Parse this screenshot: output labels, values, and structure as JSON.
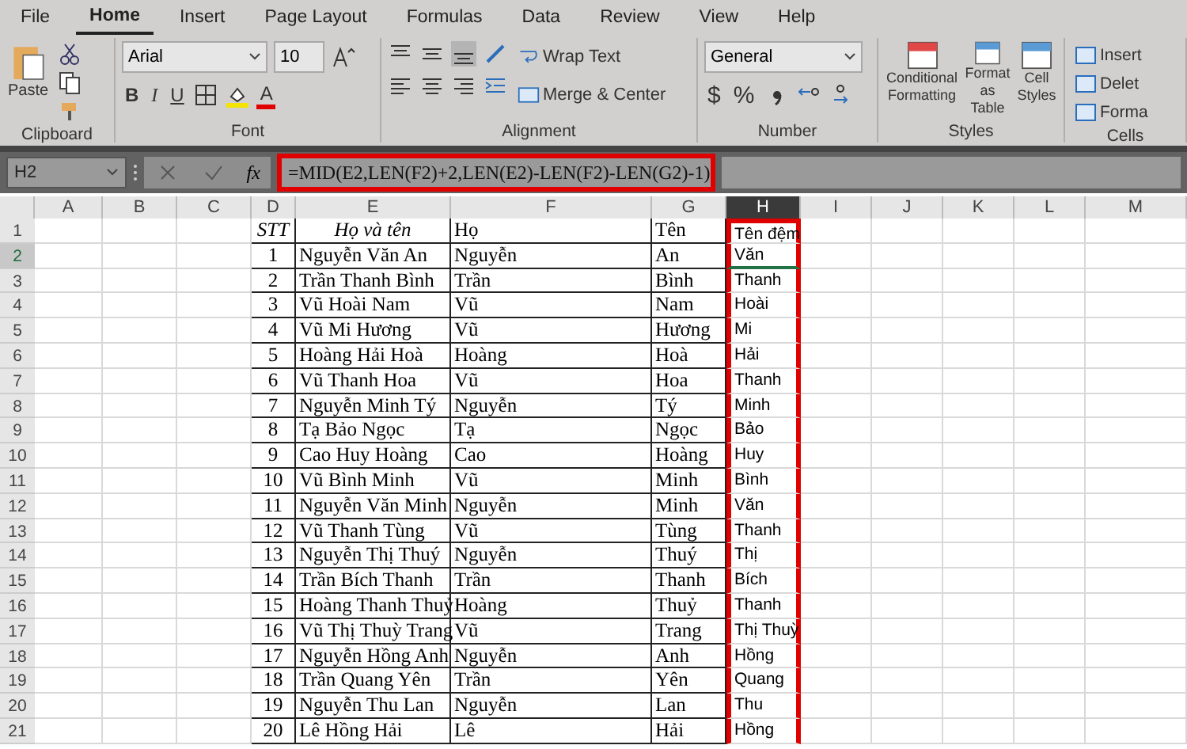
{
  "menu_tabs": [
    {
      "label": "File",
      "selected": false
    },
    {
      "label": "Home",
      "selected": true
    },
    {
      "label": "Insert",
      "selected": false
    },
    {
      "label": "Page Layout",
      "selected": false
    },
    {
      "label": "Formulas",
      "selected": false
    },
    {
      "label": "Data",
      "selected": false
    },
    {
      "label": "Review",
      "selected": false
    },
    {
      "label": "View",
      "selected": false
    },
    {
      "label": "Help",
      "selected": false
    }
  ],
  "ribbon": {
    "clipboard": {
      "label": "Clipboard",
      "paste": "Paste"
    },
    "font": {
      "label": "Font",
      "font_name": "Arial",
      "font_size": "10",
      "bold": "B",
      "italic": "I",
      "underline": "U",
      "font_color": "A"
    },
    "alignment": {
      "label": "Alignment",
      "wrap_text": "Wrap Text",
      "merge": "Merge & Center"
    },
    "number": {
      "label": "Number",
      "format": "General",
      "currency": "$",
      "percent": "%"
    },
    "styles": {
      "label": "Styles",
      "buttons": [
        "Conditional Formatting",
        "Format as Table",
        "Cell Styles"
      ]
    },
    "cells": {
      "label": "Cells",
      "buttons": [
        "Insert",
        "Delet",
        "Forma"
      ]
    }
  },
  "formula_bar": {
    "name_box": "H2",
    "fx": "fx",
    "formula": "=MID(E2,LEN(F2)+2,LEN(E2)-LEN(F2)-LEN(G2)-1)",
    "highlighted": true
  },
  "columns": [
    {
      "label": "A",
      "selected": false,
      "highlighted": false
    },
    {
      "label": "B",
      "selected": false,
      "highlighted": false
    },
    {
      "label": "C",
      "selected": false,
      "highlighted": false
    },
    {
      "label": "D",
      "selected": false,
      "highlighted": false
    },
    {
      "label": "E",
      "selected": false,
      "highlighted": false
    },
    {
      "label": "F",
      "selected": false,
      "highlighted": false
    },
    {
      "label": "G",
      "selected": false,
      "highlighted": false
    },
    {
      "label": "H",
      "selected": true,
      "highlighted": true
    },
    {
      "label": "I",
      "selected": false,
      "highlighted": false
    },
    {
      "label": "J",
      "selected": false,
      "highlighted": false
    },
    {
      "label": "K",
      "selected": false,
      "highlighted": false
    },
    {
      "label": "L",
      "selected": false,
      "highlighted": false
    },
    {
      "label": "M",
      "selected": false,
      "highlighted": false
    }
  ],
  "rows": [
    {
      "number": "1",
      "kind": "header",
      "selected": false,
      "stt": "STT",
      "full_name": "Họ và tên",
      "ho": "Họ",
      "ten": "Tên",
      "ten_dem": "Tên đệm"
    },
    {
      "number": "2",
      "kind": "data",
      "selected": true,
      "stt": "1",
      "full_name": "Nguyễn Văn An",
      "ho": "Nguyễn",
      "ten": "An",
      "ten_dem": "Văn"
    },
    {
      "number": "3",
      "kind": "data",
      "selected": false,
      "stt": "2",
      "full_name": "Trần Thanh Bình",
      "ho": "Trần",
      "ten": "Bình",
      "ten_dem": "Thanh"
    },
    {
      "number": "4",
      "kind": "data",
      "selected": false,
      "stt": "3",
      "full_name": "Vũ Hoài Nam",
      "ho": "Vũ",
      "ten": "Nam",
      "ten_dem": "Hoài"
    },
    {
      "number": "5",
      "kind": "data",
      "selected": false,
      "stt": "4",
      "full_name": "Vũ Mi Hương",
      "ho": "Vũ",
      "ten": "Hương",
      "ten_dem": "Mi"
    },
    {
      "number": "6",
      "kind": "data",
      "selected": false,
      "stt": "5",
      "full_name": "Hoàng Hải Hoà",
      "ho": "Hoàng",
      "ten": "Hoà",
      "ten_dem": "Hải"
    },
    {
      "number": "7",
      "kind": "data",
      "selected": false,
      "stt": "6",
      "full_name": "Vũ Thanh Hoa",
      "ho": "Vũ",
      "ten": "Hoa",
      "ten_dem": "Thanh"
    },
    {
      "number": "8",
      "kind": "data",
      "selected": false,
      "stt": "7",
      "full_name": "Nguyễn Minh Tý",
      "ho": "Nguyễn",
      "ten": "Tý",
      "ten_dem": "Minh"
    },
    {
      "number": "9",
      "kind": "data",
      "selected": false,
      "stt": "8",
      "full_name": "Tạ Bảo Ngọc",
      "ho": "Tạ",
      "ten": "Ngọc",
      "ten_dem": "Bảo"
    },
    {
      "number": "10",
      "kind": "data",
      "selected": false,
      "stt": "9",
      "full_name": "Cao Huy Hoàng",
      "ho": "Cao",
      "ten": "Hoàng",
      "ten_dem": "Huy"
    },
    {
      "number": "11",
      "kind": "data",
      "selected": false,
      "stt": "10",
      "full_name": "Vũ Bình Minh",
      "ho": "Vũ",
      "ten": "Minh",
      "ten_dem": "Bình"
    },
    {
      "number": "12",
      "kind": "data",
      "selected": false,
      "stt": "11",
      "full_name": "Nguyễn Văn Minh",
      "ho": "Nguyễn",
      "ten": "Minh",
      "ten_dem": "Văn"
    },
    {
      "number": "13",
      "kind": "data",
      "selected": false,
      "stt": "12",
      "full_name": "Vũ Thanh Tùng",
      "ho": "Vũ",
      "ten": "Tùng",
      "ten_dem": "Thanh"
    },
    {
      "number": "14",
      "kind": "data",
      "selected": false,
      "stt": "13",
      "full_name": "Nguyễn Thị Thuý",
      "ho": "Nguyễn",
      "ten": "Thuý",
      "ten_dem": "Thị"
    },
    {
      "number": "15",
      "kind": "data",
      "selected": false,
      "stt": "14",
      "full_name": "Trần Bích Thanh",
      "ho": "Trần",
      "ten": "Thanh",
      "ten_dem": "Bích"
    },
    {
      "number": "16",
      "kind": "data",
      "selected": false,
      "stt": "15",
      "full_name": "Hoàng Thanh Thuỷ",
      "ho": "Hoàng",
      "ten": "Thuỷ",
      "ten_dem": "Thanh"
    },
    {
      "number": "17",
      "kind": "data",
      "selected": false,
      "stt": "16",
      "full_name": "Vũ Thị Thuỳ Trang",
      "ho": "Vũ",
      "ten": "Trang",
      "ten_dem": "Thị Thuỳ"
    },
    {
      "number": "18",
      "kind": "data",
      "selected": false,
      "stt": "17",
      "full_name": "Nguyễn Hồng Anh",
      "ho": "Nguyễn",
      "ten": "Anh",
      "ten_dem": "Hồng"
    },
    {
      "number": "19",
      "kind": "data",
      "selected": false,
      "stt": "18",
      "full_name": "Trần Quang Yên",
      "ho": "Trần",
      "ten": "Yên",
      "ten_dem": "Quang"
    },
    {
      "number": "20",
      "kind": "data",
      "selected": false,
      "stt": "19",
      "full_name": "Nguyễn Thu Lan",
      "ho": "Nguyễn",
      "ten": "Lan",
      "ten_dem": "Thu"
    },
    {
      "number": "21",
      "kind": "data",
      "selected": false,
      "stt": "20",
      "full_name": "Lê Hồng Hải",
      "ho": "Lê",
      "ten": "Hải",
      "ten_dem": "Hồng"
    }
  ]
}
